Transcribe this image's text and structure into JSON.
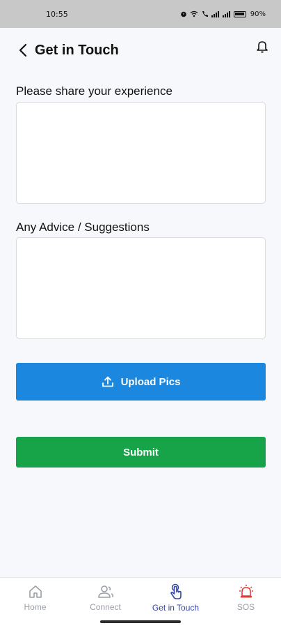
{
  "status_bar": {
    "time": "10:55",
    "battery": "90%"
  },
  "header": {
    "title": "Get in Touch"
  },
  "form": {
    "experience_label": "Please share your experience",
    "experience_value": "",
    "advice_label": "Any Advice / Suggestions",
    "advice_value": "",
    "upload_label": "Upload Pics",
    "submit_label": "Submit"
  },
  "colors": {
    "upload_button": "#1b87de",
    "submit_button": "#17a348",
    "nav_active": "#3545a6",
    "sos_icon": "#e53935"
  },
  "bottom_nav": {
    "items": [
      {
        "label": "Home",
        "icon": "home-icon",
        "active": false
      },
      {
        "label": "Connect",
        "icon": "users-icon",
        "active": false
      },
      {
        "label": "Get in Touch",
        "icon": "hand-touch-icon",
        "active": true
      },
      {
        "label": "SOS",
        "icon": "alarm-icon",
        "active": false
      }
    ]
  }
}
